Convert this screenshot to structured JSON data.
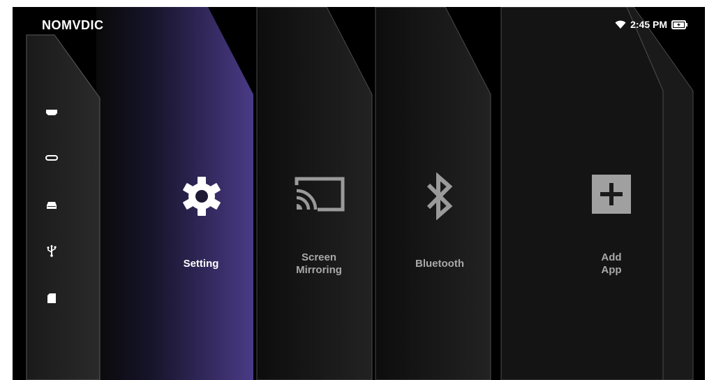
{
  "brand": {
    "logo_text": "NOMVDIC"
  },
  "status": {
    "time": "2:45 PM",
    "wifi_icon": "wifi-icon",
    "battery_icon": "battery-charging-icon"
  },
  "sources": [
    {
      "name": "hdmi-1-icon"
    },
    {
      "name": "usb-c-icon"
    },
    {
      "name": "storage-icon"
    },
    {
      "name": "usb-icon"
    },
    {
      "name": "sd-card-icon"
    }
  ],
  "tiles": [
    {
      "id": "setting",
      "icon": "gear-icon",
      "line1": "Setting",
      "line2": "",
      "active": true
    },
    {
      "id": "screen-mirroring",
      "icon": "cast-icon",
      "line1": "Screen",
      "line2": "Mirroring",
      "active": false
    },
    {
      "id": "bluetooth",
      "icon": "bluetooth-icon",
      "line1": "Bluetooth",
      "line2": "",
      "active": false
    },
    {
      "id": "add-app",
      "icon": "plus-icon",
      "line1": "Add",
      "line2": "App",
      "active": false
    }
  ],
  "colors": {
    "background": "#000000",
    "panel": "#1c1c1c",
    "active_panel_start": "#0a0a0a",
    "active_panel_end": "#4a3a86",
    "icon_inactive": "#9a9a9a",
    "text_inactive": "#a8a8a8",
    "text_active": "#ffffff"
  }
}
